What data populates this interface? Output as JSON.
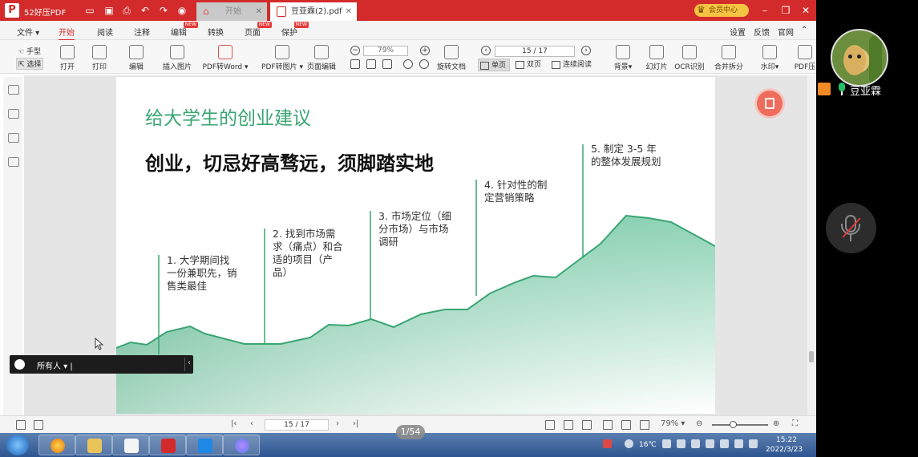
{
  "titlebar": {
    "app_name": "52好压PDF",
    "tabs": [
      {
        "label": "开始"
      },
      {
        "label": "豆亚霖(2).pdf"
      }
    ],
    "vip_label": "会员中心"
  },
  "menubar": {
    "file": "文件",
    "items": [
      "开始",
      "阅读",
      "注释",
      "编辑",
      "转换",
      "页面",
      "保护"
    ],
    "new_badge": "NEW",
    "right_items": [
      "设置",
      "反馈",
      "官网"
    ]
  },
  "toolbar": {
    "hand": "手型",
    "select": "选择",
    "tools": [
      "打开",
      "打印",
      "编辑",
      "插入图片",
      "PDF转Word",
      "PDF转图片",
      "页面编辑"
    ],
    "zoom": "79%",
    "page": "15 / 17",
    "rotate": "旋转文档",
    "view_single": "单页",
    "view_double": "双页",
    "view_continuous": "连续阅读",
    "right_tools": [
      "背景",
      "幻灯片",
      "OCR识别",
      "合并拆分",
      "水印",
      "PDF压"
    ]
  },
  "slide": {
    "title": "给大学生的创业建议",
    "subtitle": "创业，切忌好高骛远，须脚踏实地",
    "steps": [
      {
        "lines": [
          "1.  大学期间找",
          "一份兼职先，销",
          "售类最佳"
        ]
      },
      {
        "lines": [
          "2.  找到市场需",
          "求（痛点）和合",
          "适的项目（产",
          "品）"
        ]
      },
      {
        "lines": [
          "3.  市场定位（细",
          "分市场）与市场",
          "调研"
        ]
      },
      {
        "lines": [
          "4.  针对性的制",
          "定营销策略"
        ]
      },
      {
        "lines": [
          "5.  制定 3-5 年",
          "的整体发展规划"
        ]
      }
    ],
    "accent_color": "#3aa573"
  },
  "chat": {
    "recipient": "所有人"
  },
  "statusbar": {
    "page": "15 / 17",
    "zoom": "79%"
  },
  "overlay": {
    "slide_counter": "1/54"
  },
  "taskbar": {
    "temperature": "16℃",
    "time": "15:22",
    "date": "2022/3/23"
  },
  "meeting": {
    "host_name": "豆亚霖"
  }
}
